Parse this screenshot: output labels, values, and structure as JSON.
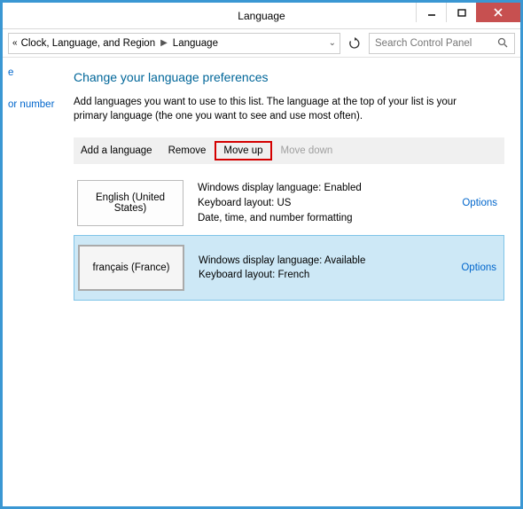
{
  "window": {
    "title": "Language"
  },
  "breadcrumb": {
    "parent": "Clock, Language, and Region",
    "current": "Language"
  },
  "search": {
    "placeholder": "Search Control Panel"
  },
  "sidebar": {
    "item1": "e",
    "item2": "or number"
  },
  "page": {
    "title": "Change your language preferences",
    "description": "Add languages you want to use to this list. The language at the top of your list is your primary language (the one you want to see and use most often)."
  },
  "toolbar": {
    "add": "Add a language",
    "remove": "Remove",
    "moveup": "Move up",
    "movedown": "Move down"
  },
  "languages": [
    {
      "name": "English (United States)",
      "line1": "Windows display language: Enabled",
      "line2": "Keyboard layout: US",
      "line3": "Date, time, and number formatting",
      "options": "Options"
    },
    {
      "name": "français (France)",
      "line1": "Windows display language: Available",
      "line2": "Keyboard layout: French",
      "line3": "",
      "options": "Options"
    }
  ]
}
